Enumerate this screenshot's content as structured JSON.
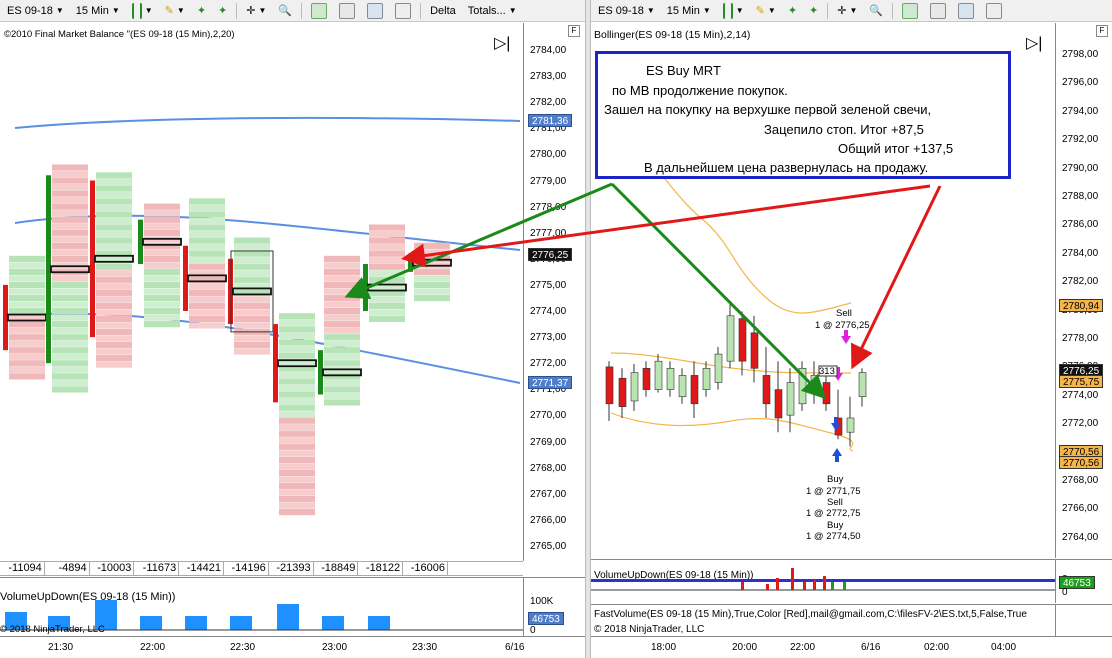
{
  "left_toolbar": {
    "instrument": "ES 09-18",
    "interval": "15 Min",
    "delta": "Delta",
    "totals": "Totals..."
  },
  "right_toolbar": {
    "instrument": "ES 09-18",
    "interval": "15 Min"
  },
  "left_chart": {
    "title": "©2010 Final Market Balance \"(ES 09-18 (15 Min),2,20)",
    "price_ticks": [
      "2784,00",
      "2783,00",
      "2782,00",
      "2781,00",
      "2780,00",
      "2779,00",
      "2778,00",
      "2777,00",
      "2776,00",
      "2775,00",
      "2774,00",
      "2773,00",
      "2772,00",
      "2771,00",
      "2770,00",
      "2769,00",
      "2768,00",
      "2767,00",
      "2766,00",
      "2765,00"
    ],
    "badge_blue_top": "2781,36",
    "badge_price": "2776,25",
    "badge_blue_bottom": "2771,37",
    "totals": [
      "-11094",
      "-4894",
      "-10003",
      "-11673",
      "-14421",
      "-14196",
      "-21393",
      "-18849",
      "-18122",
      "-16006"
    ],
    "volume_label": "VolumeUpDown(ES 09-18 (15 Min))",
    "volume_ticks": [
      "100K",
      "0"
    ],
    "volume_badge": "46753",
    "copyright": "© 2018 NinjaTrader, LLC",
    "time_ticks": [
      "21:30",
      "22:00",
      "22:30",
      "23:00",
      "23:30",
      "6/16"
    ]
  },
  "right_chart": {
    "title": "Bollinger(ES 09-18 (15 Min),2,14)",
    "price_ticks": [
      "2798,00",
      "2796,00",
      "2794,00",
      "2792,00",
      "2790,00",
      "2788,00",
      "2786,00",
      "2784,00",
      "2782,00",
      "2780,00",
      "2778,00",
      "2776,00",
      "2774,00",
      "2772,00",
      "2770,00",
      "2768,00",
      "2766,00",
      "2764,00"
    ],
    "badge_top": "2780,94",
    "badge_price": "2776,25",
    "badge_mid": "2775,75",
    "badge_bottom": "2770,56",
    "badge_bottom2": "2770,56",
    "volume_label": "VolumeUpDown(ES 09-18 (15 Min))",
    "volume_ticks": [
      "2",
      "0"
    ],
    "volume_badge": "46753",
    "fastvolume": "FastVolume(ES 09-18 (15 Min),True,Color [Red],mail@gmail.com,C:\\filesFV-2\\ES.txt,5,False,True",
    "copyright": "© 2018 NinjaTrader, LLC",
    "time_ticks": [
      "18:00",
      "20:00",
      "22:00",
      "6/16",
      "02:00",
      "04:00"
    ],
    "trades": {
      "sell_top": "Sell",
      "sell_top_price": "1 @ 2776,25",
      "buy1": "Buy",
      "buy1_price": "1 @ 2771,75",
      "sell2": "Sell",
      "sell2_price": "1 @ 2772,75",
      "buy3": "Buy",
      "buy3_price": "1 @ 2774,50",
      "marker": "313"
    }
  },
  "annotation": {
    "l1": "ES Buy MRT",
    "l2": "по МВ продолжение покупок.",
    "l3": "Зашел на покупку на верхушке первой зеленой свечи,",
    "l4": "Зацепило стоп. Итог +87,5",
    "l5": "Общий итог +137,5",
    "l6": "В дальнейшем цена развернулась на продажу."
  },
  "colors": {
    "up": "#1a8a1a",
    "down": "#e01818",
    "bollinger": "#f5b54a",
    "blue_line": "#5b8fe0",
    "annotation_border": "#1a24c8",
    "arrow_green": "#1a8a1a",
    "arrow_red": "#e01818"
  }
}
